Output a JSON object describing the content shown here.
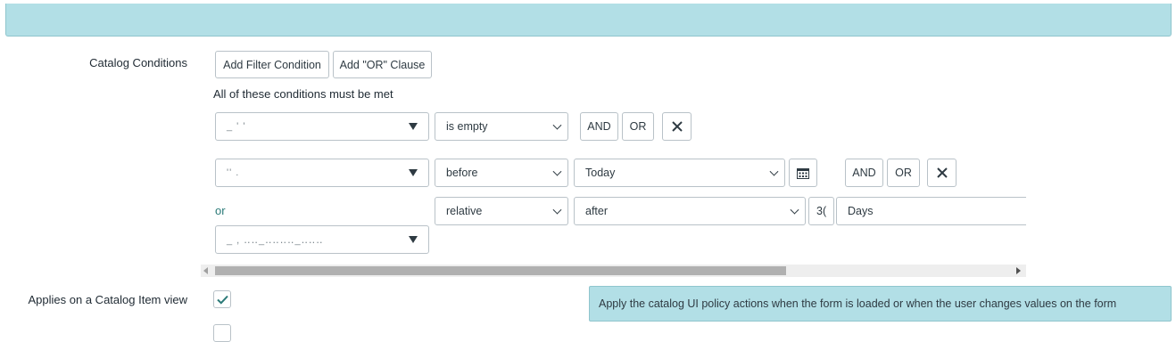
{
  "form": {
    "catalog_conditions_label": "Catalog Conditions",
    "add_filter_condition": "Add Filter Condition",
    "add_or_clause": "Add \"OR\" Clause",
    "conditions_summary": "All of these conditions must be met",
    "rows": [
      {
        "field": "_ '  '",
        "operator": "is empty",
        "and": "AND",
        "or": "OR"
      },
      {
        "field": "''    .",
        "operator": "before",
        "value": "Today",
        "and": "AND",
        "or": "OR"
      }
    ],
    "or_block": {
      "or_label": "or",
      "operator": "relative",
      "direction": "after",
      "amount": "3(",
      "unit": "Days",
      "field": "_  ,  ‥‥_‥‥‥‥_‥‥‥"
    },
    "applies_on_catalog_item_label": "Applies on a Catalog Item view",
    "applies_checked": true,
    "info_text": "Apply the catalog UI policy actions when the form is loaded or when the user changes values on the form"
  },
  "colors": {
    "banner": "#b2dfe6",
    "or_label": "#2b7a78",
    "check": "#2b7a78"
  },
  "icons": {
    "remove": "close-icon",
    "calendar": "calendar-icon",
    "dropdown": "caret-down-icon",
    "check": "check-icon"
  }
}
